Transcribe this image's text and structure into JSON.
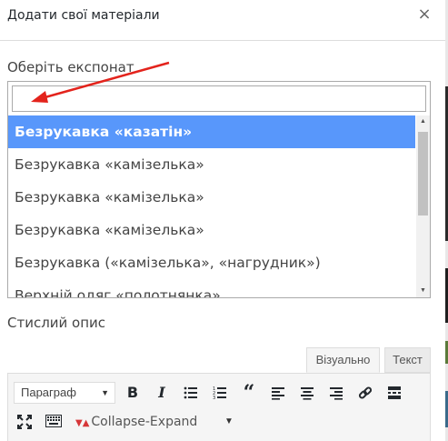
{
  "modal": {
    "title": "Додати свої матеріали",
    "close_glyph": "×"
  },
  "exhibit": {
    "label": "Оберіть експонат",
    "search_value": "",
    "options": [
      {
        "label": "Безрукавка «казатін»",
        "selected": true
      },
      {
        "label": "Безрукавка «камізелька»",
        "selected": false
      },
      {
        "label": "Безрукавка «камізелька»",
        "selected": false
      },
      {
        "label": "Безрукавка «камізелька»",
        "selected": false
      },
      {
        "label": "Безрукавка («камізелька», «нагрудник»)",
        "selected": false
      },
      {
        "label": "Верхній одяг «полотнянка»",
        "selected": false
      }
    ]
  },
  "description": {
    "label": "Стислий опис"
  },
  "editor": {
    "tab_visual": "Візуально",
    "tab_text": "Текст",
    "format_select": "Параграф",
    "collapse_label": "Collapse-Expand",
    "icons": [
      "bold-icon",
      "italic-icon",
      "bullet-list-icon",
      "numbered-list-icon",
      "blockquote-icon",
      "align-left-icon",
      "align-center-icon",
      "align-right-icon",
      "link-icon",
      "read-more-icon",
      "fullscreen-icon",
      "keyboard-icon"
    ]
  },
  "colors": {
    "selected_option": "#5897fb",
    "annotation_arrow": "#e3231c"
  }
}
